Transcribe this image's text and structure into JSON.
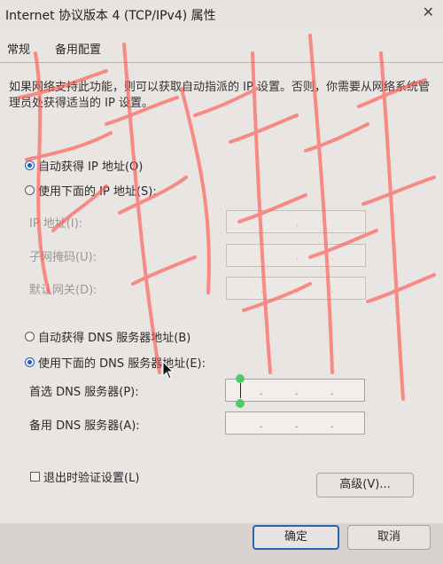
{
  "window": {
    "title": "Internet 协议版本 4 (TCP/IPv4) 属性",
    "close_icon": "close-icon"
  },
  "tabs": [
    {
      "label": "常规"
    },
    {
      "label": "备用配置"
    }
  ],
  "description": "如果网络支持此功能，则可以获取自动指派的 IP 设置。否则，你需要从网络系统管理员处获得适当的 IP 设置。",
  "ip": {
    "auto_label": "自动获得 IP 地址(O)",
    "manual_label": "使用下面的 IP 地址(S):",
    "selected": "auto",
    "address_label": "IP 地址(I):",
    "subnet_label": "子网掩码(U):",
    "gateway_label": "默认网关(D):"
  },
  "dns": {
    "auto_label": "自动获得 DNS 服务器地址(B)",
    "manual_label": "使用下面的 DNS 服务器地址(E):",
    "selected": "manual",
    "preferred_label": "首选 DNS 服务器(P):",
    "alternate_label": "备用 DNS 服务器(A):"
  },
  "validate_on_exit": {
    "label": "退出时验证设置(L)",
    "checked": false
  },
  "buttons": {
    "advanced": "高级(V)...",
    "ok": "确定",
    "cancel": "取消"
  },
  "colors": {
    "accent": "#1f5fb8",
    "dialog_bg": "#e9e5e3",
    "watermark": "#ff5a52",
    "handle": "#52c968"
  }
}
